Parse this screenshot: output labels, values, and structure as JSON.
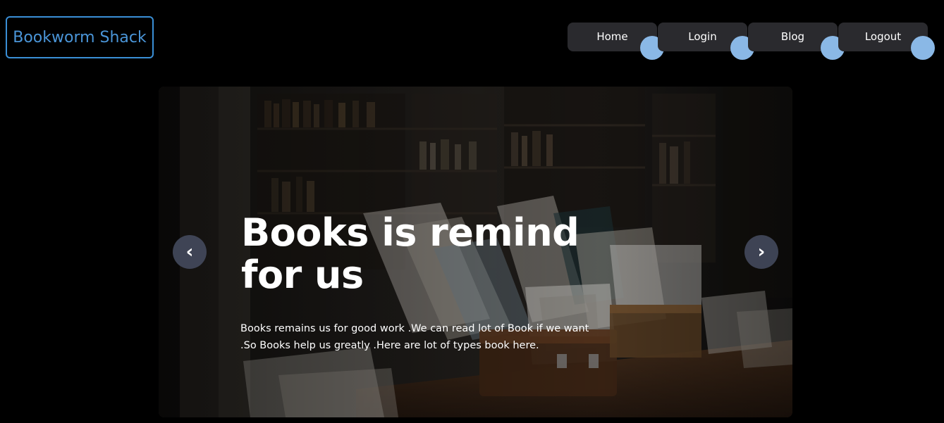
{
  "header": {
    "brand": "Bookworm Shack",
    "nav": [
      {
        "label": "Home"
      },
      {
        "label": "Login"
      },
      {
        "label": "Blog"
      },
      {
        "label": "Logout"
      }
    ]
  },
  "hero": {
    "title": "Books is remind for us",
    "text": "Books remains us for good work .We can read lot of Book if we want .So Books help us greatly .Here are lot of types book here.",
    "prev_icon": "chevron-left-icon",
    "next_icon": "chevron-right-icon",
    "prev_glyph": "‹",
    "next_glyph": "›"
  },
  "colors": {
    "background": "#000000",
    "brand_border": "#3a8fd6",
    "brand_text": "#4a95d8",
    "nav_bg": "#2a2a2e",
    "nav_dot": "#8ab8e6",
    "carousel_btn": "#464e62"
  }
}
